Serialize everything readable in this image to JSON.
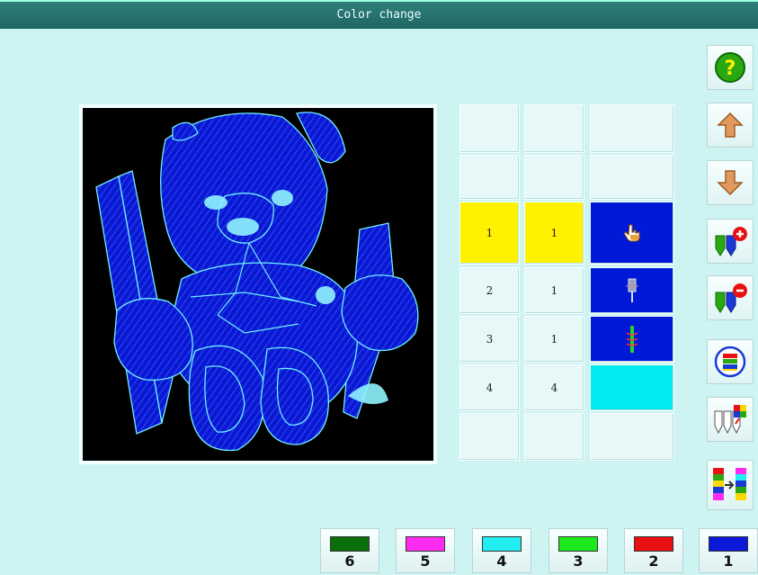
{
  "window": {
    "title": "Color change"
  },
  "table": {
    "rows": [
      {
        "c1": "",
        "c2": "",
        "state": "empty"
      },
      {
        "c1": "",
        "c2": "",
        "state": "empty"
      },
      {
        "c1": "1",
        "c2": "1",
        "state": "selected",
        "icon": "hand-pointer-icon"
      },
      {
        "c1": "2",
        "c2": "1",
        "state": "normal",
        "icon": "needle-icon"
      },
      {
        "c1": "3",
        "c2": "1",
        "state": "normal",
        "icon": "thread-spool-icon"
      },
      {
        "c1": "4",
        "c2": "4",
        "state": "normal",
        "icon": "none"
      },
      {
        "c1": "",
        "c2": "",
        "state": "empty"
      }
    ],
    "colors": {
      "selected_bg": "#fff200",
      "icon_cell_bg": "#0019d6",
      "cyan_cell_bg": "#00eaf0"
    }
  },
  "side_buttons": [
    {
      "name": "help-button",
      "icon": "question-icon"
    },
    {
      "name": "move-up-button",
      "icon": "arrow-up-icon"
    },
    {
      "name": "move-down-button",
      "icon": "arrow-down-icon"
    },
    {
      "name": "add-color-button",
      "icon": "add-needle-icon"
    },
    {
      "name": "remove-color-button",
      "icon": "remove-needle-icon"
    },
    {
      "name": "color-cycle-button",
      "icon": "color-cycle-icon"
    },
    {
      "name": "needle-assign-button",
      "icon": "needle-assign-icon"
    },
    {
      "name": "color-transfer-button",
      "icon": "color-transfer-icon"
    }
  ],
  "color_buttons": [
    {
      "number": "6",
      "color": "#0a6e0a"
    },
    {
      "number": "5",
      "color": "#ff2bf0"
    },
    {
      "number": "4",
      "color": "#22eef2"
    },
    {
      "number": "3",
      "color": "#1ee81e"
    },
    {
      "number": "2",
      "color": "#e81010"
    },
    {
      "number": "1",
      "color": "#0a18d8"
    }
  ]
}
